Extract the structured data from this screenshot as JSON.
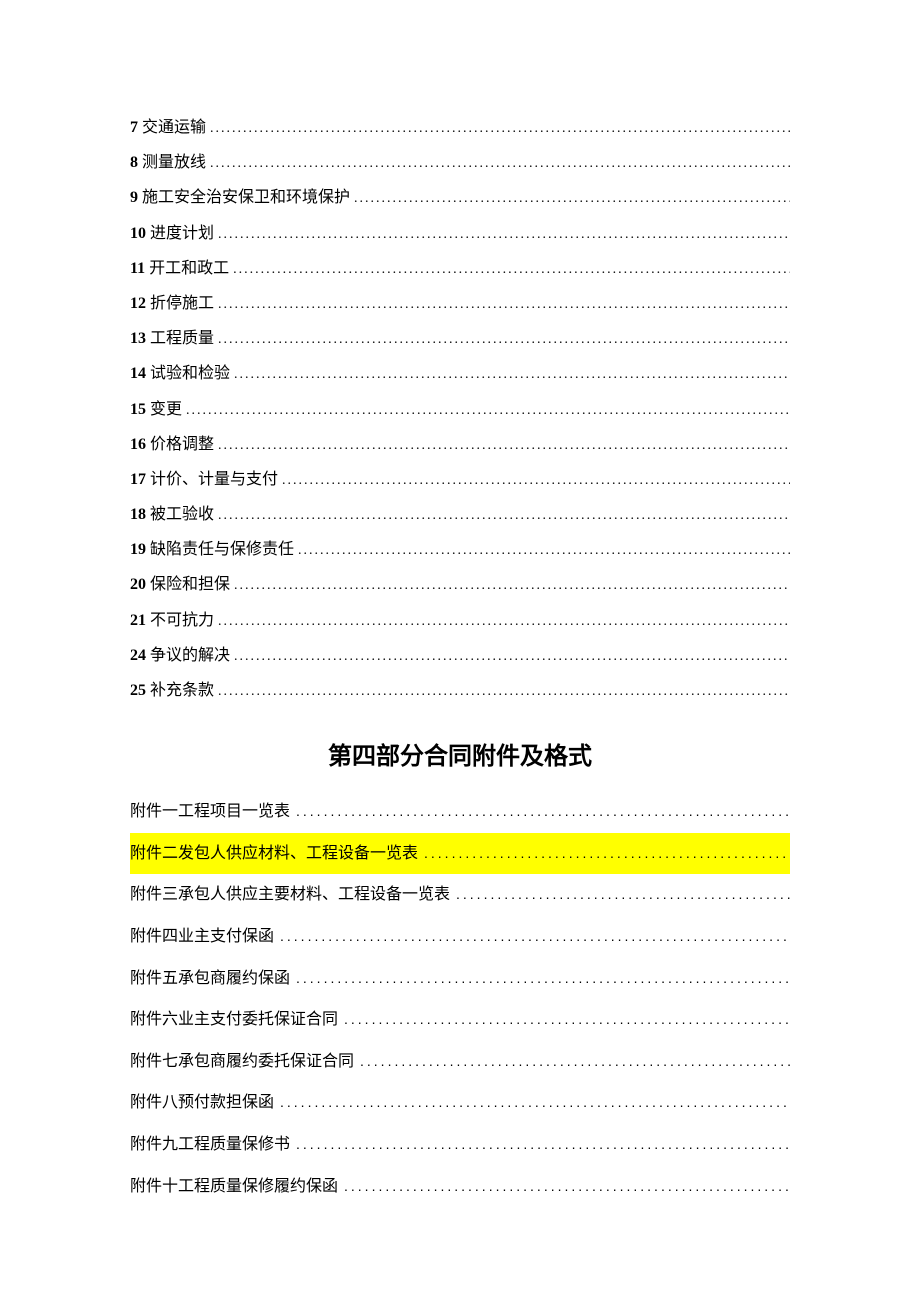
{
  "toc": [
    {
      "num": "7",
      "label": "交通运输"
    },
    {
      "num": "8",
      "label": "测量放线"
    },
    {
      "num": "9",
      "label": "施工安全治安保卫和环境保护"
    },
    {
      "num": "10",
      "label": "进度计划"
    },
    {
      "num": "11",
      "label": "开工和政工"
    },
    {
      "num": "12",
      "label": "折停施工"
    },
    {
      "num": "13",
      "label": "工程质量"
    },
    {
      "num": "14",
      "label": "试验和检验"
    },
    {
      "num": "15",
      "label": "变更"
    },
    {
      "num": "16",
      "label": "价格调整"
    },
    {
      "num": "17",
      "label": "计价、计量与支付"
    },
    {
      "num": "18",
      "label": "被工验收"
    },
    {
      "num": "19",
      "label": "缺陷责任与保修责任"
    },
    {
      "num": "20",
      "label": "保险和担保"
    },
    {
      "num": "21",
      "label": "不可抗力"
    },
    {
      "num": "24",
      "label": "争议的解决"
    },
    {
      "num": "25",
      "label": "补充条款"
    }
  ],
  "section_title": "第四部分合同附件及格式",
  "attachments": [
    {
      "label": "附件一工程项目一览表",
      "highlight": false
    },
    {
      "label": "附件二发包人供应材料、工程设备一览表",
      "highlight": true
    },
    {
      "label": "附件三承包人供应主要材料、工程设备一览表",
      "highlight": false
    },
    {
      "label": "附件四业主支付保函",
      "highlight": false
    },
    {
      "label": "附件五承包商履约保函",
      "highlight": false
    },
    {
      "label": "附件六业主支付委托保证合同",
      "highlight": false
    },
    {
      "label": "附件七承包商履约委托保证合同",
      "highlight": false
    },
    {
      "label": "附件八预付款担保函",
      "highlight": false
    },
    {
      "label": "附件九工程质量保修书",
      "highlight": false
    },
    {
      "label": "附件十工程质量保修履约保函",
      "highlight": false
    }
  ],
  "dots": "............................................................................................................................"
}
